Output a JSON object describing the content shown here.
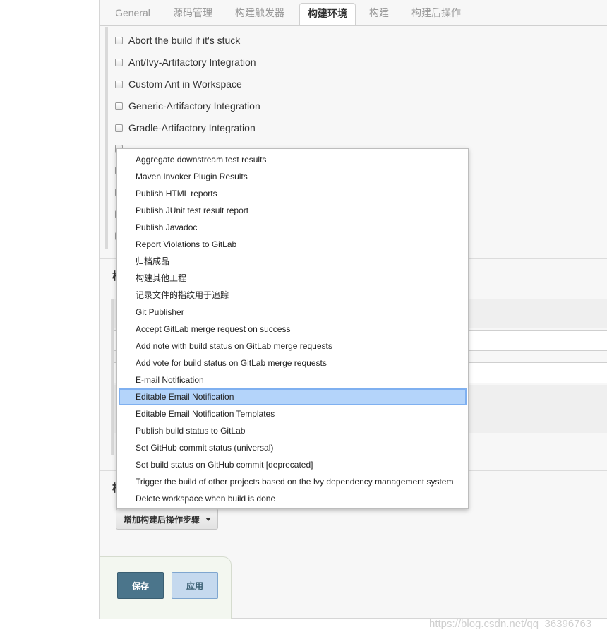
{
  "tabs": [
    {
      "label": "General",
      "active": false
    },
    {
      "label": "源码管理",
      "active": false
    },
    {
      "label": "构建触发器",
      "active": false
    },
    {
      "label": "构建环境",
      "active": true
    },
    {
      "label": "构建",
      "active": false
    },
    {
      "label": "构建后操作",
      "active": false
    }
  ],
  "build_env": {
    "options": [
      {
        "label": "Abort the build if it's stuck",
        "checked": false
      },
      {
        "label": "Ant/Ivy-Artifactory Integration",
        "checked": false
      },
      {
        "label": "Custom Ant in Workspace",
        "checked": false
      },
      {
        "label": "Generic-Artifactory Integration",
        "checked": false
      },
      {
        "label": "Gradle-Artifactory Integration",
        "checked": false
      }
    ]
  },
  "post_build": {
    "add_step_label": "增加构建后操作步骤"
  },
  "dropdown": {
    "items": [
      "Aggregate downstream test results",
      "Maven Invoker Plugin Results",
      "Publish HTML reports",
      "Publish JUnit test result report",
      "Publish Javadoc",
      "Report Violations to GitLab",
      "归档成品",
      "构建其他工程",
      "记录文件的指纹用于追踪",
      "Git Publisher",
      "Accept GitLab merge request on success",
      "Add note with build status on GitLab merge requests",
      "Add vote for build status on GitLab merge requests",
      "E-mail Notification",
      "Editable Email Notification",
      "Editable Email Notification Templates",
      "Publish build status to GitLab",
      "Set GitHub commit status (universal)",
      "Set build status on GitHub commit [deprecated]",
      "Trigger the build of other projects based on the Ivy dependency management system",
      "Delete workspace when build is done"
    ],
    "highlighted": "Editable Email Notification",
    "highlight_color": "#b4d4fa"
  },
  "buttons": {
    "save": "保存",
    "apply": "应用"
  },
  "colors": {
    "save_bg": "#4b758b",
    "apply_bg": "#c5d9ee"
  },
  "watermark": "https://blog.csdn.net/qq_36396763"
}
